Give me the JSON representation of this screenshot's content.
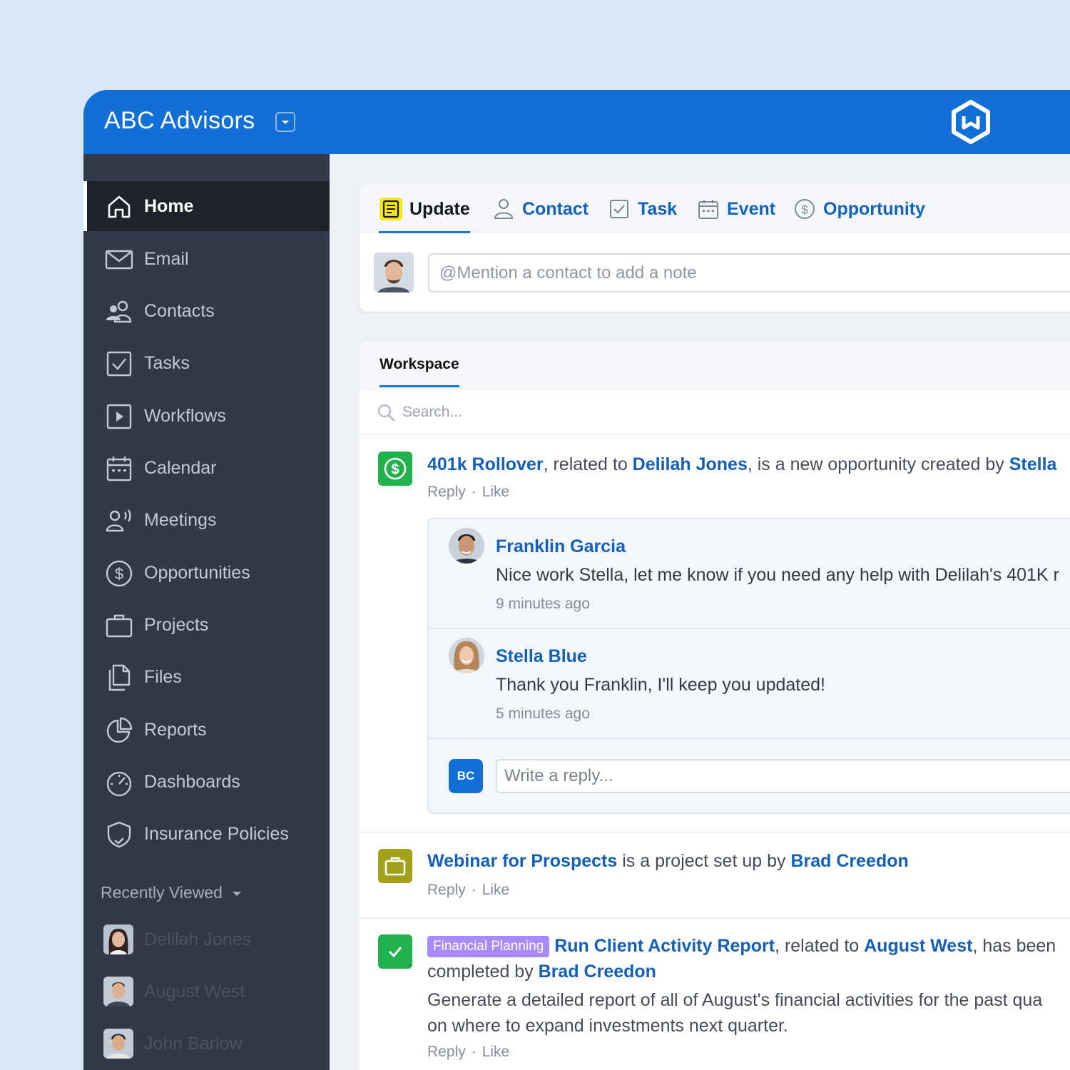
{
  "header": {
    "title": "ABC Advisors"
  },
  "sidebar": {
    "items": [
      {
        "label": "Home",
        "icon": "home-icon",
        "active": true
      },
      {
        "label": "Email",
        "icon": "envelope-icon"
      },
      {
        "label": "Contacts",
        "icon": "people-icon"
      },
      {
        "label": "Tasks",
        "icon": "checkbox-icon"
      },
      {
        "label": "Workflows",
        "icon": "play-square-icon"
      },
      {
        "label": "Calendar",
        "icon": "calendar-icon"
      },
      {
        "label": "Meetings",
        "icon": "speaking-person-icon"
      },
      {
        "label": "Opportunities",
        "icon": "dollar-circle-icon"
      },
      {
        "label": "Projects",
        "icon": "briefcase-icon"
      },
      {
        "label": "Files",
        "icon": "files-icon"
      },
      {
        "label": "Reports",
        "icon": "pie-chart-icon"
      },
      {
        "label": "Dashboards",
        "icon": "gauge-icon"
      },
      {
        "label": "Insurance Policies",
        "icon": "shield-icon"
      }
    ],
    "recently_viewed": {
      "label": "Recently Viewed",
      "items": [
        {
          "name": "Delilah Jones"
        },
        {
          "name": "August West"
        },
        {
          "name": "John Barlow"
        }
      ]
    }
  },
  "composer": {
    "tabs": [
      {
        "label": "Update",
        "active": true
      },
      {
        "label": "Contact"
      },
      {
        "label": "Task"
      },
      {
        "label": "Event"
      },
      {
        "label": "Opportunity"
      }
    ],
    "placeholder": "@Mention a contact to add a note"
  },
  "workspace": {
    "tab": "Workspace",
    "search_placeholder": "Search...",
    "reply_label": "Reply",
    "like_label": "Like",
    "feed": [
      {
        "opportunity": "401k Rollover",
        "t1": ", related to ",
        "contact": "Delilah Jones",
        "t2": ", is a new opportunity created by ",
        "creator": "Stella",
        "comments": [
          {
            "name": "Franklin Garcia",
            "text": "Nice work Stella, let me know if you need any help with Delilah's 401K r",
            "time": "9 minutes ago"
          },
          {
            "name": "Stella Blue",
            "text": "Thank you Franklin, I'll keep you updated!",
            "time": "5 minutes ago"
          }
        ],
        "reply_initials": "BC",
        "reply_placeholder": "Write a reply..."
      },
      {
        "project": "Webinar for Prospects",
        "t1": " is a project set up by ",
        "creator": "Brad Creedon"
      },
      {
        "tag": "Financial Planning",
        "task": "Run Client Activity Report",
        "t1": ", related to ",
        "contact": "August West",
        "t2": ", has been",
        "t3": "completed by ",
        "completer": "Brad Creedon",
        "desc1": "Generate a detailed report of all of August's financial activities for the past qua",
        "desc2": "on where to expand investments next quarter."
      }
    ]
  },
  "colors": {
    "brand": "#126fd6",
    "sidebar": "#313847",
    "link": "#1460b8",
    "opportunity_badge": "#22b14c",
    "project_badge": "#a3a11b",
    "tag": "#a78bfa"
  }
}
